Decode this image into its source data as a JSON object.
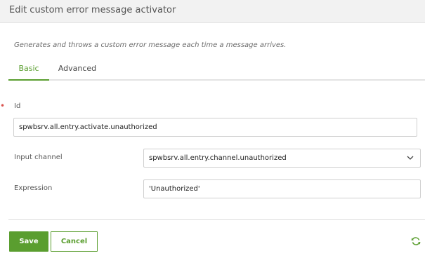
{
  "dialog": {
    "title": "Edit custom error message activator",
    "description": "Generates and throws a custom error message each time a message arrives."
  },
  "tabs": [
    {
      "label": "Basic",
      "active": true
    },
    {
      "label": "Advanced",
      "active": false
    }
  ],
  "form": {
    "required_mark": "•",
    "id": {
      "label": "Id",
      "value": "spwbsrv.all.entry.activate.unauthorized"
    },
    "input_channel": {
      "label": "Input channel",
      "value": "spwbsrv.all.entry.channel.unauthorized"
    },
    "expression": {
      "label": "Expression",
      "value": "'Unauthorized'"
    }
  },
  "buttons": {
    "save": "Save",
    "cancel": "Cancel"
  },
  "icons": {
    "dropdown": "chevron-down-icon",
    "refresh": "refresh-icon"
  },
  "colors": {
    "accent": "#5a9e2f",
    "required": "#d9534f",
    "header_bg": "#f2f2f2"
  }
}
